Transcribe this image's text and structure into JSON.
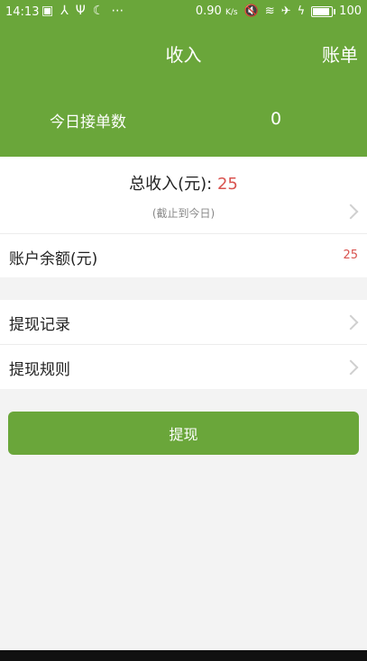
{
  "status_bar": {
    "time": "14:13",
    "speed": "0.90",
    "speed_unit": "K/s",
    "battery": "100",
    "battery_level": 1.0
  },
  "header": {
    "title": "收入",
    "bill_button": "账单",
    "today_orders_label": "今日接单数",
    "today_orders_value": "0"
  },
  "income": {
    "total_label": "总收入(元):",
    "total_value": "25",
    "note": "(截止到今日)"
  },
  "balance": {
    "label": "账户余额(元)",
    "value": "25"
  },
  "menu": {
    "withdraw_records": "提现记录",
    "withdraw_rules": "提现规则"
  },
  "actions": {
    "withdraw_button": "提现"
  },
  "colors": {
    "primary_green": "#6aa63a",
    "accent_red": "#d9534f"
  }
}
